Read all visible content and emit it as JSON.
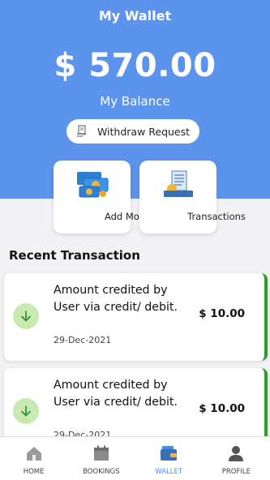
{
  "header": {
    "title": "My Wallet",
    "balance": "$ 570.00",
    "balance_label": "My Balance",
    "withdraw_label": "Withdraw Request",
    "background_color": "#5c93ec"
  },
  "quick_actions": [
    {
      "label": "Add Money",
      "icon": "money-bills-icon"
    },
    {
      "label": "Transactions",
      "icon": "transactions-receipt-icon"
    }
  ],
  "section_title": "Recent Transaction",
  "transactions": [
    {
      "description": "Amount credited by User via credit/ debit.",
      "date": "29-Dec-2021",
      "amount": "$ 10.00",
      "icon": "arrow-down-icon"
    },
    {
      "description": "Amount credited by User via credit/ debit.",
      "date": "29-Dec-2021",
      "amount": "$ 10.00",
      "icon": "arrow-down-icon"
    }
  ],
  "nav": {
    "items": [
      {
        "label": "HOME",
        "icon": "home-icon"
      },
      {
        "label": "BOOKINGS",
        "icon": "calendar-icon"
      },
      {
        "label": "WALLET",
        "icon": "wallet-icon",
        "active": true
      },
      {
        "label": "PROFILE",
        "icon": "person-icon"
      }
    ],
    "active_color": "#4a8de8"
  },
  "colors": {
    "credit_accent": "#2f9b2f",
    "arrow_bg": "#c8eab0"
  }
}
